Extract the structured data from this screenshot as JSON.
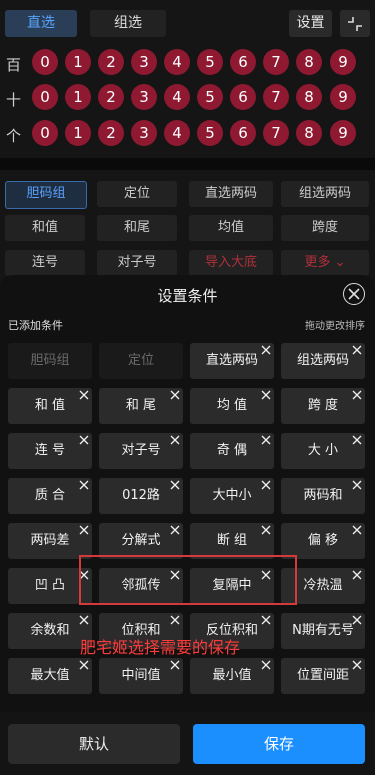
{
  "top": {
    "tab_direct": "直选",
    "tab_group": "组选",
    "settings_label": "设置"
  },
  "digit_rows": [
    {
      "label": "百",
      "digits": [
        "0",
        "1",
        "2",
        "3",
        "4",
        "5",
        "6",
        "7",
        "8",
        "9"
      ]
    },
    {
      "label": "十",
      "digits": [
        "0",
        "1",
        "2",
        "3",
        "4",
        "5",
        "6",
        "7",
        "8",
        "9"
      ]
    },
    {
      "label": "个",
      "digits": [
        "0",
        "1",
        "2",
        "3",
        "4",
        "5",
        "6",
        "7",
        "8",
        "9"
      ]
    }
  ],
  "background_buttons": [
    [
      "胆码组",
      "定位",
      "直选两码",
      "组选两码"
    ],
    [
      "和值",
      "和尾",
      "均值",
      "跨度"
    ],
    [
      "连号",
      "对子号",
      "导入大底",
      "更多 ⌄"
    ]
  ],
  "sheet": {
    "title": "设置条件",
    "added_label": "已添加条件",
    "drag_hint": "拖动更改排序",
    "chips": [
      [
        "胆码组",
        "定位",
        "直选两码",
        "组选两码"
      ],
      [
        "和 值",
        "和 尾",
        "均 值",
        "跨 度"
      ],
      [
        "连 号",
        "对子号",
        "奇 偶",
        "大 小"
      ],
      [
        "质 合",
        "012路",
        "大中小",
        "两码和"
      ],
      [
        "两码差",
        "分解式",
        "断 组",
        "偏 移"
      ],
      [
        "凹 凸",
        "邻孤传",
        "复隔中",
        "冷热温"
      ],
      [
        "余数和",
        "位积和",
        "反位积和",
        "N期有无号"
      ],
      [
        "最大值",
        "中间值",
        "最小值",
        "位置间距"
      ]
    ],
    "annotation": "肥宅姬选择需要的保存"
  },
  "bottom": {
    "default_label": "默认",
    "save_label": "保存"
  },
  "colors": {
    "accent_blue": "#1c8fff",
    "ball_red": "#8e1931",
    "annotation_red": "#ff3a3a"
  }
}
